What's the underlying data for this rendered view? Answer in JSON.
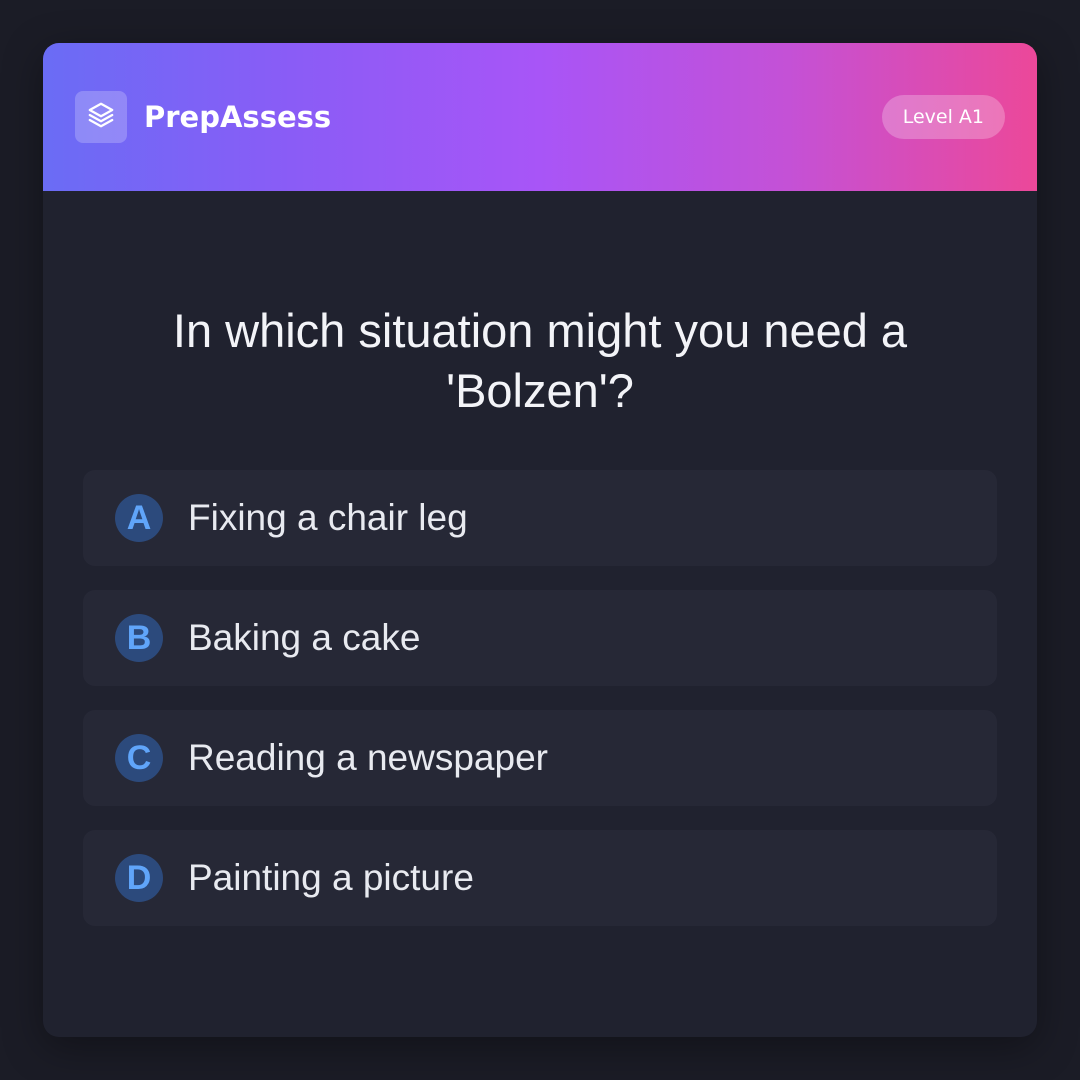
{
  "header": {
    "brand": "PrepAssess",
    "logo_icon": "layers-icon",
    "level": "Level A1",
    "gradient": [
      "#6a6cf5",
      "#a855f7",
      "#ec4899"
    ]
  },
  "question": {
    "text": "In which situation might you need a 'Bolzen'?"
  },
  "options": [
    {
      "letter": "A",
      "text": "Fixing a chair leg"
    },
    {
      "letter": "B",
      "text": "Baking a cake"
    },
    {
      "letter": "C",
      "text": "Reading a newspaper"
    },
    {
      "letter": "D",
      "text": "Painting a picture"
    }
  ],
  "colors": {
    "background": "#1b1c26",
    "card": "#20222f",
    "option_bg": "#262836",
    "letter_bg": "#2c4a7c",
    "letter_fg": "#60a5fa"
  }
}
